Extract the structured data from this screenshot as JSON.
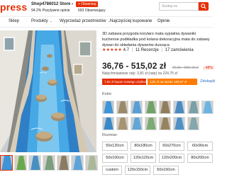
{
  "header": {
    "logo": "press",
    "store_name": "Shop4786012 Store",
    "store_name_chevron": "›",
    "follow_label": "+ Obserwuj",
    "store_rating": "94.2% Pozytywne opinie",
    "store_followers": "693 Obserwujący",
    "search_placeholder": "Szukaj na"
  },
  "nav": {
    "items": [
      {
        "label": "Sklep"
      },
      {
        "label": "Produkty"
      },
      {
        "label": "Wyprzedaż przedmiotów"
      },
      {
        "label": "Najczęściej kupowane"
      },
      {
        "label": "Opinie"
      }
    ]
  },
  "product": {
    "title": "3D zabawa przygoda korytarz mata sypialnia dywaniki kuchenne podkładka pod kolana dekoracyjna mata do zabawy dywan do składania dywanów dusząca",
    "stars": "★★★★★",
    "rating": "4.7",
    "reviews": "11 Recenzje",
    "orders": "17 zamówienia",
    "price": "36,76 - 515,02 zł",
    "old_price": "70,66 - 990,43 zł",
    "discount": "-48%",
    "installments": "Natychmiastowe raty: 3,81 zł (ratę) na 224,75 zł",
    "coupon1": "7,62 zł kupon nowego użytkownika",
    "coupon2": "3,81 zł na każde 190,57 zł",
    "more_link": "Zdobądź",
    "color_label": "Kolor:",
    "size_label": "Rozmiar:",
    "sizes_row1": [
      "50x120cm",
      "80x180cm",
      "60x270cm",
      "60x90cm"
    ],
    "sizes_row2": [
      "50x100cm",
      "120x120cm",
      "120x200cm",
      "80x200cm"
    ],
    "sizes_row3": [
      "custom",
      "120x150cm",
      "50x160cm"
    ]
  },
  "colors": {
    "accent": "#e62e04",
    "coupon_orange": "#ff7a00",
    "link": "#2b6ec2"
  }
}
